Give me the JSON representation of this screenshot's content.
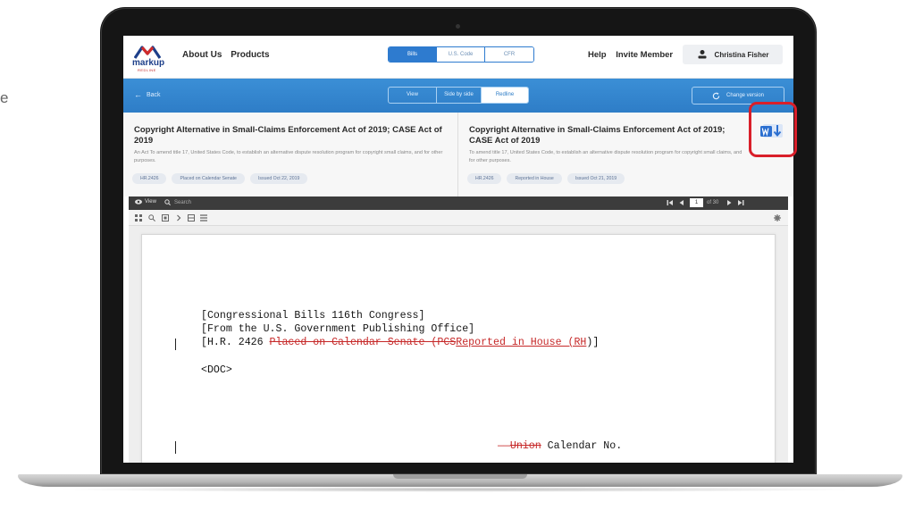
{
  "left_fragment": "e",
  "header": {
    "logo": {
      "word": "markup",
      "sub": "REDLINE"
    },
    "nav": [
      "About Us",
      "Products"
    ],
    "tabs": [
      {
        "label": "Bills",
        "active": true
      },
      {
        "label": "U.S. Code",
        "active": false
      },
      {
        "label": "CFR",
        "active": false
      }
    ],
    "right_nav": [
      "Help",
      "Invite Member"
    ],
    "user_name": "Christina Fisher"
  },
  "toolbar": {
    "back_label": "Back",
    "view_modes": [
      {
        "label": "View",
        "active": false
      },
      {
        "label": "Side by side",
        "active": false
      },
      {
        "label": "Redline",
        "active": true
      }
    ],
    "change_version_label": "Change version"
  },
  "left_doc": {
    "title": "Copyright Alternative in Small-Claims Enforcement Act of 2019; CASE Act of 2019",
    "description": "An Act To amend title 17, United States Code, to establish an alternative dispute resolution program for copyright small claims, and for other purposes.",
    "tags": [
      "HR.2426",
      "Placed on Calendar Senate",
      "Issued Oct 22, 2019"
    ]
  },
  "right_doc": {
    "title": "Copyright Alternative in Small-Claims Enforcement Act of 2019; CASE Act of 2019",
    "description": "To amend title 17, United States Code, to establish an alternative dispute resolution program for copyright small claims, and for other purposes.",
    "tags": [
      "HR.2426",
      "Reported in House",
      "Issued Oct 21, 2019"
    ]
  },
  "viewer": {
    "view_label": "View",
    "search_label": "Search",
    "page_number": "1",
    "page_total": "of 30"
  },
  "document": {
    "line1": "[Congressional Bills 116th Congress]",
    "line2": "[From the U.S. Government Publishing Office]",
    "line3_prefix": "[H.R. 2426 ",
    "line3_deleted": "Placed on Calendar Senate (PCS",
    "line3_inserted": "Reported in House (RH",
    "line3_suffix": ")]",
    "line4": "<DOC>",
    "line5_deleted": "Union",
    "line5_rest": " Calendar No."
  },
  "colors": {
    "brand_blue": "#2e7dc7",
    "logo_navy": "#1d3f8a",
    "redline": "#c62828",
    "callout": "#d91f2a",
    "word_blue": "#2b6fd0"
  },
  "icons": {
    "download_word": "word-download-icon",
    "gear": "gear-icon",
    "eye": "eye-icon",
    "search": "search-icon"
  }
}
